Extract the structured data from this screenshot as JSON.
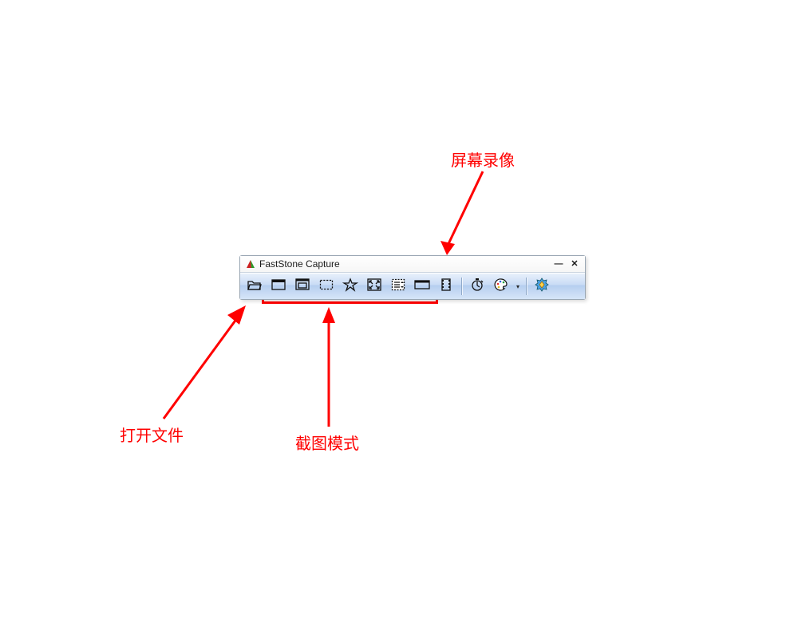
{
  "window": {
    "title": "FastStone Capture"
  },
  "toolbar": {
    "open_file": {
      "name": "open-file-button",
      "icon": "folder-open-icon"
    },
    "capture_window": {
      "name": "capture-window-button",
      "icon": "active-window-icon"
    },
    "capture_object": {
      "name": "capture-object-button",
      "icon": "window-object-icon"
    },
    "capture_rect": {
      "name": "capture-rectangle-button",
      "icon": "rectangle-region-icon"
    },
    "capture_freehand": {
      "name": "capture-freehand-button",
      "icon": "freehand-region-icon"
    },
    "capture_full": {
      "name": "capture-fullscreen-button",
      "icon": "fullscreen-icon"
    },
    "capture_scroll": {
      "name": "capture-scrolling-button",
      "icon": "scrolling-window-icon"
    },
    "capture_fixed": {
      "name": "capture-fixed-button",
      "icon": "fixed-region-icon"
    },
    "screen_record": {
      "name": "screen-recorder-button",
      "icon": "film-icon"
    },
    "delay": {
      "name": "delay-button",
      "icon": "timer-icon"
    },
    "output_options": {
      "name": "output-options-button",
      "icon": "palette-icon"
    },
    "settings": {
      "name": "settings-button",
      "icon": "settings-icon"
    }
  },
  "annotations": {
    "open_file": "打开文件",
    "capture_modes": "截图模式",
    "screen_record": "屏幕录像"
  },
  "colors": {
    "accent_red": "#ff0000"
  }
}
